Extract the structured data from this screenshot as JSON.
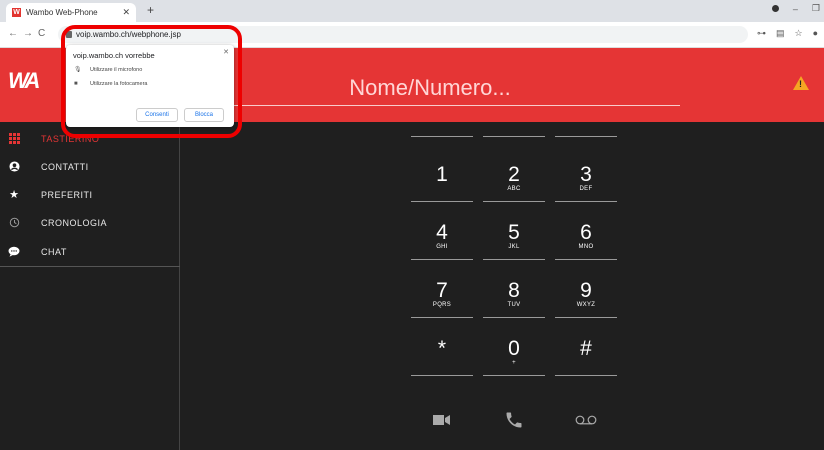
{
  "browser": {
    "tab_title": "Wambo Web-Phone",
    "tab_favicon": "W",
    "url": "voip.wambo.ch/webphone.jsp"
  },
  "header": {
    "logo": "WA",
    "search_placeholder": "Nome/Numero..."
  },
  "sidebar": {
    "items": [
      {
        "label": "TASTIERINO",
        "icon": "dialpad-icon"
      },
      {
        "label": "CONTATTI",
        "icon": "contact-icon"
      },
      {
        "label": "PREFERITI",
        "icon": "star-icon"
      },
      {
        "label": "CRONOLOGIA",
        "icon": "history-icon"
      },
      {
        "label": "CHAT",
        "icon": "chat-icon"
      }
    ]
  },
  "keypad": {
    "keys": [
      {
        "digit": "1",
        "letters": ""
      },
      {
        "digit": "2",
        "letters": "ABC"
      },
      {
        "digit": "3",
        "letters": "DEF"
      },
      {
        "digit": "4",
        "letters": "GHI"
      },
      {
        "digit": "5",
        "letters": "JKL"
      },
      {
        "digit": "6",
        "letters": "MNO"
      },
      {
        "digit": "7",
        "letters": "PQRS"
      },
      {
        "digit": "8",
        "letters": "TUV"
      },
      {
        "digit": "9",
        "letters": "WXYZ"
      },
      {
        "digit": "*",
        "letters": ""
      },
      {
        "digit": "0",
        "letters": "+"
      },
      {
        "digit": "#",
        "letters": ""
      }
    ]
  },
  "popup": {
    "title": "voip.wambo.ch vorrebbe",
    "perm_mic": "Utilizzare il microfono",
    "perm_cam": "Utilizzare la fotocamera",
    "allow": "Consenti",
    "block": "Blocca"
  },
  "colors": {
    "brand_red": "#e53535",
    "background": "#1f1f1f",
    "warning": "#f5a623"
  }
}
